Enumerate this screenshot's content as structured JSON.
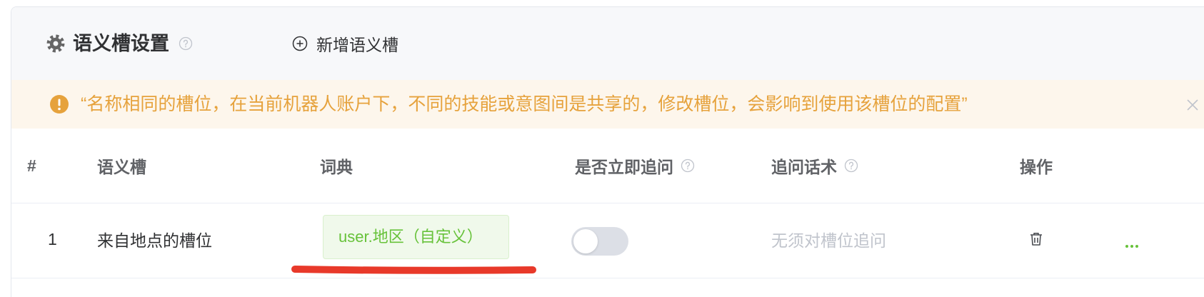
{
  "header": {
    "title": "语义槽设置",
    "title_icon": "gear-icon",
    "help_icon": "help-icon",
    "add_button": {
      "icon": "plus-circle-icon",
      "label": "新增语义槽"
    }
  },
  "alert": {
    "icon": "warning-icon",
    "message": "“名称相同的槽位，在当前机器人账户下，不同的技能或意图间是共享的，修改槽位，会影响到使用该槽位的配置”",
    "close_icon": "close-icon"
  },
  "table": {
    "columns": [
      {
        "label": "#"
      },
      {
        "label": "语义槽"
      },
      {
        "label": "词典"
      },
      {
        "label": "是否立即追问",
        "help_icon": "help-icon"
      },
      {
        "label": "追问话术",
        "help_icon": "help-icon"
      },
      {
        "label": "操作"
      }
    ],
    "rows": [
      {
        "index": "1",
        "slot_name": "来自地点的槽位",
        "dictionary_tag": "user.地区（自定义）",
        "ask_immediately": false,
        "ask_text_placeholder": "无须对槽位追问",
        "actions": [
          "trash-icon",
          "more-icon"
        ]
      }
    ]
  },
  "colors": {
    "panel_header_bg": "#f7f8fa",
    "alert_bg": "#fdf6ec",
    "warning": "#e6a23c",
    "success": "#67c23a",
    "tag_bg": "#f0f9eb",
    "annotation_red": "#e8392a",
    "text_primary": "#303133",
    "text_secondary": "#606266",
    "placeholder": "#c0c4cc"
  }
}
